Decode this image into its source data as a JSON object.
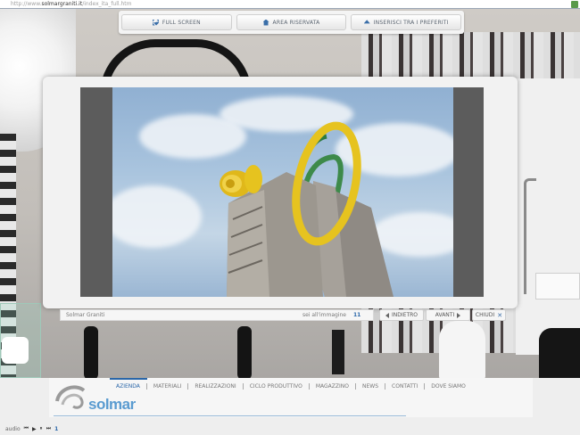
{
  "browser": {
    "url_prefix": "http://www.",
    "url_host": "solmargraniti.it",
    "url_path": "/index_ita_full.htm"
  },
  "toolbar": {
    "fullscreen_label": "FULL SCREEN",
    "reserved_label": "AREA RISERVATA",
    "favorites_label": "INSERISCI TRA I PREFERITI"
  },
  "viewer": {
    "caption": "Solmar Graniti",
    "position_text": "sei all'immagine",
    "position_number": "11",
    "prev_label": "INDIETRO",
    "next_label": "AVANTI",
    "close_label": "CHIUDI"
  },
  "menu": {
    "items": [
      {
        "label": "AZIENDA",
        "active": true
      },
      {
        "label": "MATERIALI"
      },
      {
        "label": "REALIZZAZIONI"
      },
      {
        "label": "CICLO PRODUTTIVO"
      },
      {
        "label": "MAGAZZINO"
      },
      {
        "label": "NEWS"
      },
      {
        "label": "CONTATTI"
      },
      {
        "label": "DOVE SIAMO"
      }
    ]
  },
  "brand": {
    "name": "solmar",
    "color": "#5a9bd0"
  },
  "audio": {
    "label": "audio",
    "track": "1",
    "controls": [
      "⏮",
      "▶",
      "⏸",
      "⏭"
    ]
  },
  "colors": {
    "accent": "#2a66a8",
    "sculpture_ring": "#e6c31f"
  }
}
